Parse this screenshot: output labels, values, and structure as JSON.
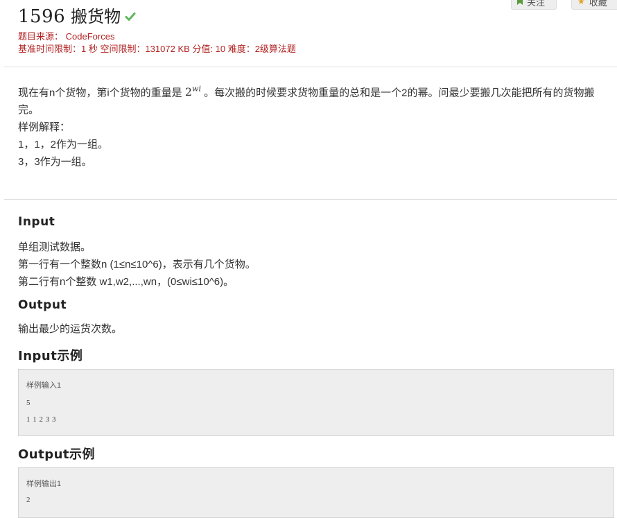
{
  "problem": {
    "number": "1596",
    "title": "搬货物",
    "solved_icon": "check-icon",
    "source_label": "题目来源：",
    "source_value": "CodeForces",
    "limits_text": "基准时间限制：1 秒 空间限制：131072 KB 分值: 10 难度：2级算法题"
  },
  "toolbar": {
    "follow_label": "关注",
    "follow_icon": "bookmark-icon",
    "favorite_label": "收藏",
    "favorite_icon": "star-icon"
  },
  "description": {
    "line1_before": "现在有n个货物，第i个货物的重量是 ",
    "line1_math_base": "2",
    "line1_math_exp": "wi",
    "line1_after": " 。每次搬的时候要求货物重量的总和是一个2的幂。问最少要搬几次能把所有的货物搬完。",
    "example_heading": "样例解释：",
    "example_line1": "1，1，2作为一组。",
    "example_line2": "3，3作为一组。"
  },
  "input_section": {
    "heading": "Input",
    "lines": [
      "单组测试数据。",
      "第一行有一个整数n (1≤n≤10^6)，表示有几个货物。",
      "第二行有n个整数 w1,w2,...,wn，(0≤wi≤10^6)。"
    ]
  },
  "output_section": {
    "heading": "Output",
    "text": "输出最少的运货次数。"
  },
  "input_example": {
    "heading": "Input示例",
    "label": "样例输入1",
    "lines": [
      "5",
      "1 1 2 3 3"
    ]
  },
  "output_example": {
    "heading": "Output示例",
    "label": "样例输出1",
    "lines": [
      "2"
    ]
  },
  "colors": {
    "meta_red": "#b22222",
    "check_green": "#5cb85c",
    "sample_bg": "#eeeeee"
  }
}
